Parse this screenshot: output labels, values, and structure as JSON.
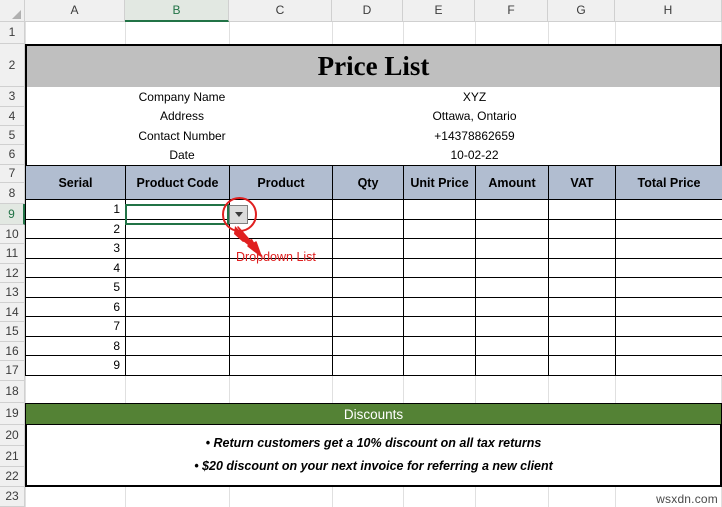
{
  "app": {
    "type": "spreadsheet",
    "watermark": "wsxdn.com"
  },
  "colors": {
    "title_fill": "#bfbfbf",
    "table_header_fill": "#b1bdd0",
    "discount_fill": "#548235",
    "selection_green": "#217346",
    "annotation_red": "#e02020"
  },
  "columns": [
    {
      "label": "A",
      "selected": false
    },
    {
      "label": "B",
      "selected": true
    },
    {
      "label": "C",
      "selected": false
    },
    {
      "label": "D",
      "selected": false
    },
    {
      "label": "E",
      "selected": false
    },
    {
      "label": "F",
      "selected": false
    },
    {
      "label": "G",
      "selected": false
    },
    {
      "label": "H",
      "selected": false
    }
  ],
  "rows": [
    {
      "label": "1",
      "selected": false
    },
    {
      "label": "2",
      "selected": false
    },
    {
      "label": "3",
      "selected": false
    },
    {
      "label": "4",
      "selected": false
    },
    {
      "label": "5",
      "selected": false
    },
    {
      "label": "6",
      "selected": false
    },
    {
      "label": "7",
      "selected": false
    },
    {
      "label": "8",
      "selected": false
    },
    {
      "label": "9",
      "selected": true
    },
    {
      "label": "10",
      "selected": false
    },
    {
      "label": "11",
      "selected": false
    },
    {
      "label": "12",
      "selected": false
    },
    {
      "label": "13",
      "selected": false
    },
    {
      "label": "14",
      "selected": false
    },
    {
      "label": "15",
      "selected": false
    },
    {
      "label": "16",
      "selected": false
    },
    {
      "label": "17",
      "selected": false
    },
    {
      "label": "18",
      "selected": false
    },
    {
      "label": "19",
      "selected": false
    },
    {
      "label": "20",
      "selected": false
    },
    {
      "label": "21",
      "selected": false
    },
    {
      "label": "22",
      "selected": false
    },
    {
      "label": "23",
      "selected": false
    }
  ],
  "report": {
    "title": "Price List",
    "info": [
      {
        "label": "Company Name",
        "value": "XYZ"
      },
      {
        "label": "Address",
        "value": "Ottawa, Ontario"
      },
      {
        "label": "Contact Number",
        "value": "+14378862659"
      },
      {
        "label": "Date",
        "value": "10-02-22"
      }
    ],
    "table": {
      "headers": [
        "Serial",
        "Product Code",
        "Product",
        "Qty",
        "Unit Price",
        "Amount",
        "VAT",
        "Total Price"
      ],
      "rows": [
        {
          "serial": "1",
          "product_code": "",
          "product": "",
          "qty": "",
          "unit_price": "",
          "amount": "",
          "vat": "",
          "total_price": ""
        },
        {
          "serial": "2",
          "product_code": "",
          "product": "",
          "qty": "",
          "unit_price": "",
          "amount": "",
          "vat": "",
          "total_price": ""
        },
        {
          "serial": "3",
          "product_code": "",
          "product": "",
          "qty": "",
          "unit_price": "",
          "amount": "",
          "vat": "",
          "total_price": ""
        },
        {
          "serial": "4",
          "product_code": "",
          "product": "",
          "qty": "",
          "unit_price": "",
          "amount": "",
          "vat": "",
          "total_price": ""
        },
        {
          "serial": "5",
          "product_code": "",
          "product": "",
          "qty": "",
          "unit_price": "",
          "amount": "",
          "vat": "",
          "total_price": ""
        },
        {
          "serial": "6",
          "product_code": "",
          "product": "",
          "qty": "",
          "unit_price": "",
          "amount": "",
          "vat": "",
          "total_price": ""
        },
        {
          "serial": "7",
          "product_code": "",
          "product": "",
          "qty": "",
          "unit_price": "",
          "amount": "",
          "vat": "",
          "total_price": ""
        },
        {
          "serial": "8",
          "product_code": "",
          "product": "",
          "qty": "",
          "unit_price": "",
          "amount": "",
          "vat": "",
          "total_price": ""
        },
        {
          "serial": "9",
          "product_code": "",
          "product": "",
          "qty": "",
          "unit_price": "",
          "amount": "",
          "vat": "",
          "total_price": ""
        }
      ]
    },
    "discounts": {
      "heading": "Discounts",
      "lines": [
        "• Return customers get a 10% discount on all tax returns",
        "• $20 discount on your next invoice for referring a new client"
      ]
    }
  },
  "active_cell": {
    "reference": "B9",
    "value": ""
  },
  "dropdown": {
    "icon": "chevron-down-icon",
    "open": false
  },
  "annotation": {
    "label": "Dropdown List",
    "target": "B9 dropdown arrow"
  }
}
